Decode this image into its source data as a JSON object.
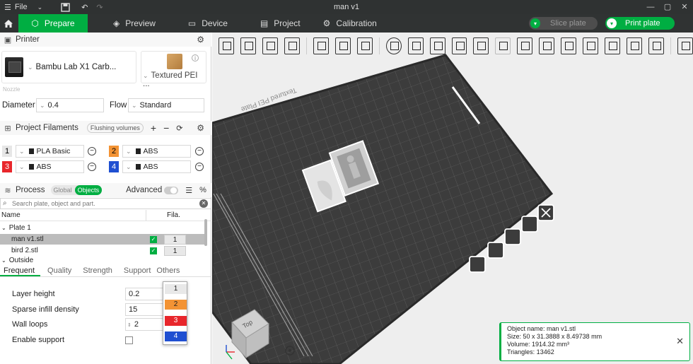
{
  "window": {
    "menu": "File",
    "title": "man v1",
    "controls": [
      "—",
      "▢",
      "✕"
    ]
  },
  "tabs": [
    {
      "label": "Prepare",
      "icon": "cube-icon",
      "active": true
    },
    {
      "label": "Preview",
      "icon": "layers-icon",
      "active": false
    },
    {
      "label": "Device",
      "icon": "device-icon",
      "active": false
    },
    {
      "label": "Project",
      "icon": "project-icon",
      "active": false
    },
    {
      "label": "Calibration",
      "icon": "calibration-icon",
      "active": false
    }
  ],
  "actions": {
    "slice": "Slice plate",
    "print": "Print plate"
  },
  "printer": {
    "heading": "Printer",
    "name": "Bambu Lab X1 Carb...",
    "plate": "Textured PEI ...",
    "nozzle_label": "Nozzle",
    "diameter_label": "Diameter",
    "diameter_value": "0.4",
    "flow_label": "Flow",
    "flow_value": "Standard"
  },
  "filaments": {
    "heading": "Project Filaments",
    "flushing": "Flushing volumes",
    "items": [
      {
        "num": "1",
        "type": "PLA Basic",
        "color": "#e6e6e6"
      },
      {
        "num": "2",
        "type": "ABS",
        "color": "#f39334"
      },
      {
        "num": "3",
        "type": "ABS",
        "color": "#e8262b"
      },
      {
        "num": "4",
        "type": "ABS",
        "color": "#1f4fd1"
      }
    ]
  },
  "process": {
    "heading": "Process",
    "global": "Global",
    "objects": "Objects",
    "advanced": "Advanced"
  },
  "objects": {
    "search_placeholder": "Search plate, object and part.",
    "col_name": "Name",
    "col_fila": "Fila.",
    "plate": "Plate 1",
    "rows": [
      {
        "name": "man v1.stl",
        "fila": "1",
        "selected": true
      },
      {
        "name": "bird 2.stl",
        "fila": "1",
        "selected": false
      }
    ],
    "outside": "Outside"
  },
  "fila_dropdown": [
    "1",
    "2",
    "3",
    "4"
  ],
  "param_tabs": [
    "Frequent",
    "Quality",
    "Strength",
    "Support",
    "Others"
  ],
  "params": [
    {
      "label": "Layer height",
      "value": "0.2"
    },
    {
      "label": "Sparse infill density",
      "value": "15"
    },
    {
      "label": "Wall loops",
      "value": "2"
    },
    {
      "label": "Enable support",
      "value": ""
    }
  ],
  "plate_label": "Textured PEI Plate",
  "view_cube": "Top",
  "object_info": {
    "name": "Object name: man v1.stl",
    "size": "Size: 50 x 31.3888 x 8.49738 mm",
    "volume": "Volume: 1914.32 mm³",
    "triangles": "Triangles: 13462"
  }
}
